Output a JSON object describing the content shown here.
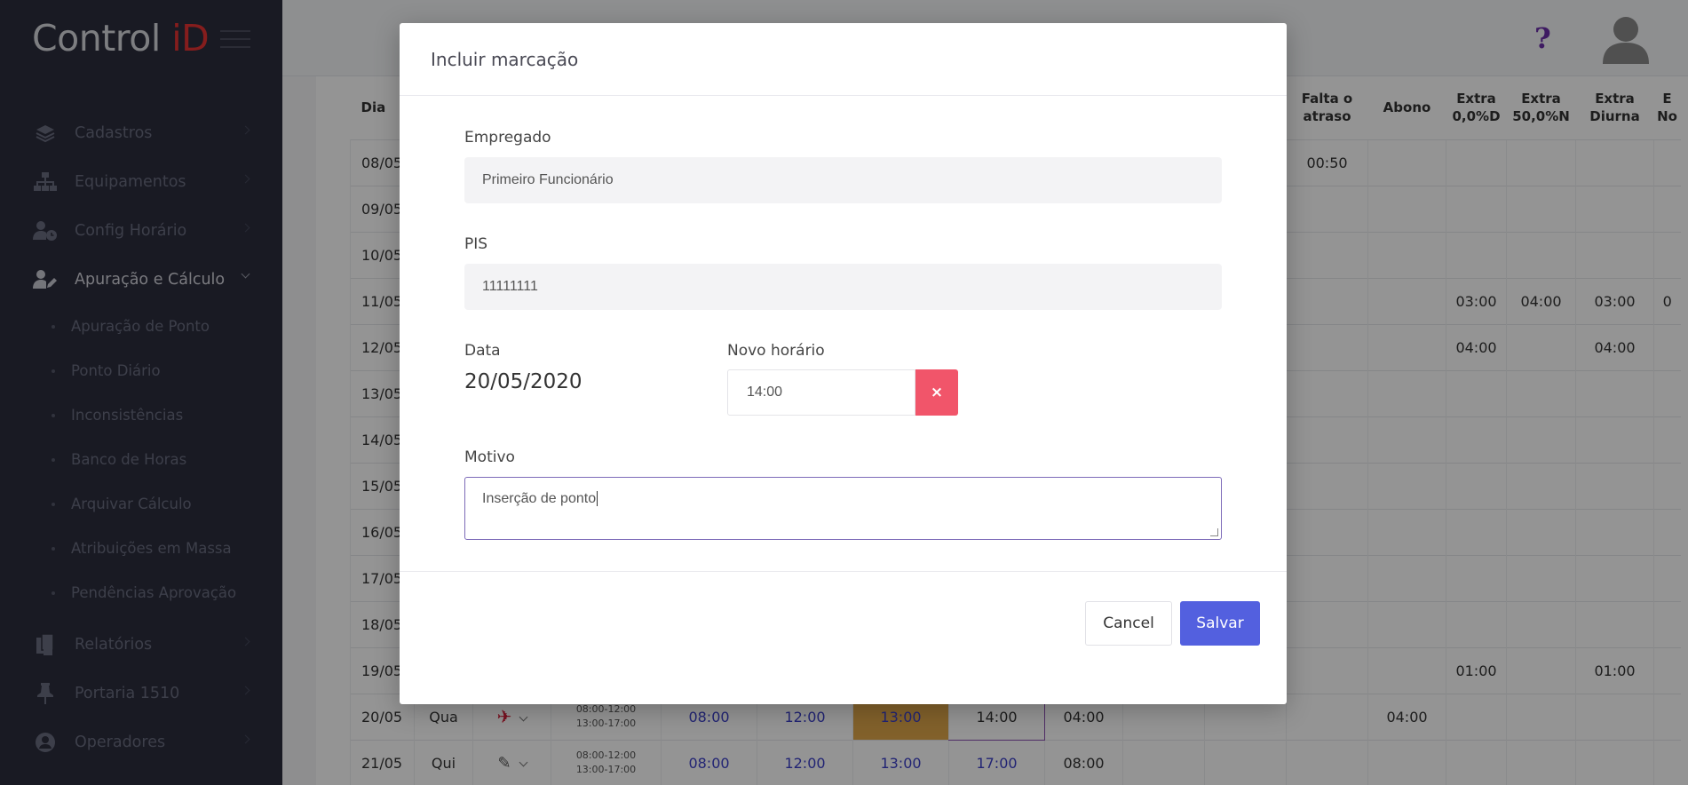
{
  "app": {
    "logo_text": "Control ",
    "logo_accent": "iD"
  },
  "sidebar": {
    "items": [
      {
        "label": "Cadastros",
        "icon": "layers-icon"
      },
      {
        "label": "Equipamentos",
        "icon": "network-icon"
      },
      {
        "label": "Config Horário",
        "icon": "user-clock-icon"
      },
      {
        "label": "Apuração e Cálculo",
        "icon": "user-edit-icon",
        "active": true
      },
      {
        "label": "Relatórios",
        "icon": "files-icon"
      },
      {
        "label": "Portaria 1510",
        "icon": "pin-icon"
      },
      {
        "label": "Operadores",
        "icon": "user-circle-icon"
      }
    ],
    "submenu": [
      "Apuração de Ponto",
      "Ponto Diário",
      "Inconsistências",
      "Banco de Horas",
      "Arquivar Cálculo",
      "Atribuições em Massa",
      "Pendências Aprovação"
    ]
  },
  "topbar": {
    "help_symbol": "?"
  },
  "table": {
    "headers": {
      "day": "Dia",
      "falta_1": "Falta o",
      "falta_2": "atraso",
      "abono": "Abono",
      "extra1_1": "Extra",
      "extra1_2": "0,0%D",
      "extra2_1": "Extra",
      "extra2_2": "50,0%N",
      "extra3_1": "Extra",
      "extra3_2": "Diurna",
      "extra4_1": "E",
      "extra4_2": "No"
    },
    "rows": [
      {
        "day": "08/05",
        "falta": "00:50",
        "e1": "",
        "e2": "",
        "e3": ""
      },
      {
        "day": "09/05",
        "falta": "",
        "e1": "",
        "e2": "",
        "e3": ""
      },
      {
        "day": "10/05",
        "falta": "",
        "e1": "",
        "e2": "",
        "e3": ""
      },
      {
        "day": "11/05",
        "falta": "",
        "e1": "03:00",
        "e2": "04:00",
        "e3": "03:00",
        "e4": "0"
      },
      {
        "day": "12/05",
        "falta": "",
        "e1": "04:00",
        "e2": "",
        "e3": "04:00"
      },
      {
        "day": "13/05",
        "falta": "",
        "e1": "",
        "e2": "",
        "e3": ""
      },
      {
        "day": "14/05",
        "falta": "",
        "e1": "",
        "e2": "",
        "e3": ""
      },
      {
        "day": "15/05",
        "falta": "",
        "e1": "",
        "e2": "",
        "e3": ""
      },
      {
        "day": "16/05",
        "falta": "",
        "e1": "",
        "e2": "",
        "e3": ""
      },
      {
        "day": "17/05",
        "falta": "",
        "e1": "",
        "e2": "",
        "e3": ""
      },
      {
        "day": "18/05",
        "falta": "",
        "e1": "",
        "e2": "",
        "e3": ""
      },
      {
        "day": "19/05",
        "falta": "",
        "e1": "01:00",
        "e2": "",
        "e3": "01:00"
      }
    ],
    "row_2005": {
      "day": "20/05",
      "weekday": "Qua",
      "sched1": "08:00-12:00",
      "sched2": "13:00-17:00",
      "t1": "08:00",
      "t2": "12:00",
      "t3": "13:00",
      "t4": "14:00",
      "worked": "04:00",
      "falta": "04:00"
    },
    "row_2105": {
      "day": "21/05",
      "weekday": "Qui",
      "sched1": "08:00-12:00",
      "sched2": "13:00-17:00",
      "t1": "08:00",
      "t2": "12:00",
      "t3": "13:00",
      "t4": "17:00",
      "worked": "08:00"
    }
  },
  "modal": {
    "title": "Incluir marcação",
    "employee_label": "Empregado",
    "employee_value": "Primeiro Funcionário",
    "pis_label": "PIS",
    "pis_value": "11111111",
    "date_label": "Data",
    "date_value": "20/05/2020",
    "time_label": "Novo horário",
    "time_value": "14:00",
    "clear_symbol": "×",
    "reason_label": "Motivo",
    "reason_value": "Inserção de ponto",
    "cancel_label": "Cancel",
    "save_label": "Salvar"
  },
  "colors": {
    "sidebar_bg": "#2b2d3d",
    "brand_red": "#e63232",
    "primary": "#5360df",
    "danger": "#f1556a",
    "help": "#6b2fa9",
    "late_cell": "#e1a84b"
  }
}
